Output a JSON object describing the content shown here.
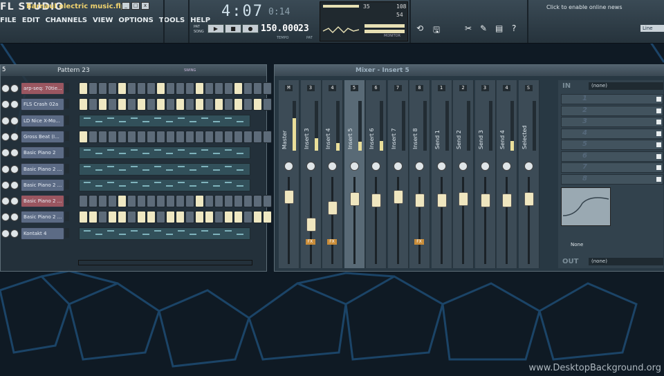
{
  "app": {
    "logo": "FL STUDIO",
    "project_title": "Barnaul electric music.flp"
  },
  "menu": [
    "FILE",
    "EDIT",
    "CHANNELS",
    "VIEW",
    "OPTIONS",
    "TOOLS",
    "HELP"
  ],
  "transport": {
    "song_position": "4:07",
    "song_ticks": "0:14",
    "tempo": "150.000",
    "tempo_label": "TEMPO",
    "pattern": "23",
    "pattern_label": "PAT",
    "mode_pat": "PAT",
    "mode_song": "SONG"
  },
  "monitor": {
    "val1": "35",
    "val2": "108",
    "val3": "54",
    "label": "MONITOR"
  },
  "news": {
    "text": "Click to enable online news"
  },
  "snap": {
    "value": "Line"
  },
  "channel_rack": {
    "number": "5",
    "pattern_name": "Pattern 23",
    "swing_label": "SWING",
    "channels": [
      {
        "name": "arp-seq: 70tie...",
        "style": "red",
        "steps": [
          1,
          0,
          0,
          0,
          1,
          0,
          0,
          0,
          1,
          0,
          0,
          0,
          1,
          0,
          0,
          0,
          1,
          0,
          0,
          0
        ]
      },
      {
        "name": "FLS Crash 02a",
        "style": "blue",
        "steps": [
          1,
          0,
          1,
          0,
          1,
          0,
          1,
          0,
          1,
          0,
          1,
          0,
          1,
          0,
          1,
          0,
          1,
          0,
          1,
          0
        ]
      },
      {
        "name": "LD Nice X-Mo...",
        "style": "blue",
        "piano": true
      },
      {
        "name": "Gross Beat (I...",
        "style": "blue",
        "steps": [
          1,
          0,
          0,
          0,
          0,
          0,
          0,
          0,
          0,
          0,
          0,
          0,
          0,
          0,
          0,
          0,
          0,
          0,
          0,
          0
        ]
      },
      {
        "name": "Basic Piano 2",
        "style": "blue",
        "piano": true
      },
      {
        "name": "Basic Piano 2 ...",
        "style": "blue",
        "piano": true
      },
      {
        "name": "Basic Piano 2 ...",
        "style": "blue",
        "piano": true
      },
      {
        "name": "Basic Piano 2 ...",
        "style": "red",
        "steps": [
          0,
          0,
          0,
          0,
          1,
          0,
          0,
          0,
          0,
          0,
          0,
          0,
          1,
          0,
          0,
          0,
          0,
          0,
          0,
          0
        ]
      },
      {
        "name": "Basic Piano 2 ...",
        "style": "blue",
        "steps": [
          1,
          1,
          0,
          1,
          1,
          0,
          1,
          1,
          0,
          1,
          1,
          0,
          1,
          1,
          0,
          1,
          1,
          0,
          1,
          1
        ]
      },
      {
        "name": "Kontakt 4",
        "style": "blue",
        "piano": true
      }
    ]
  },
  "mixer": {
    "title": "Mixer - Insert 5",
    "tracks": [
      {
        "name": "Master",
        "num": "M",
        "meter": 0.65,
        "fader": 0.82,
        "fx": false
      },
      {
        "name": "Insert 3",
        "num": "3",
        "meter": 0.25,
        "fader": 0.45,
        "fx": true
      },
      {
        "name": "Insert 4",
        "num": "4",
        "meter": 0.15,
        "fader": 0.68,
        "fx": true
      },
      {
        "name": "Insert 5",
        "num": "5",
        "meter": 0.18,
        "fader": 0.8,
        "fx": false,
        "selected": true
      },
      {
        "name": "Insert 6",
        "num": "6",
        "meter": 0.2,
        "fader": 0.78,
        "fx": false
      },
      {
        "name": "Insert 7",
        "num": "7",
        "meter": 0.0,
        "fader": 0.82,
        "fx": false
      },
      {
        "name": "Insert 8",
        "num": "8",
        "meter": 0.0,
        "fader": 0.78,
        "fx": true
      },
      {
        "name": "Send 1",
        "num": "1",
        "meter": 0.0,
        "fader": 0.78,
        "fx": false
      },
      {
        "name": "Send 2",
        "num": "2",
        "meter": 0.0,
        "fader": 0.8,
        "fx": false
      },
      {
        "name": "Send 3",
        "num": "3",
        "meter": 0.0,
        "fader": 0.78,
        "fx": false
      },
      {
        "name": "Send 4",
        "num": "4",
        "meter": 0.2,
        "fader": 0.78,
        "fx": false
      },
      {
        "name": "Selected",
        "num": "S",
        "meter": 0.0,
        "fader": 0.8,
        "fx": false
      }
    ],
    "in_label": "IN",
    "in_value": "(none)",
    "slots": [
      "1",
      "2",
      "3",
      "4",
      "5",
      "6",
      "7",
      "8"
    ],
    "none_label": "None",
    "out_label": "OUT",
    "out_value": "(none)"
  },
  "watermark": "www.DesktopBackground.org",
  "colors": {
    "step_on": "#efe8c2",
    "fader": "#efe6bf",
    "fx": "#c98d3a"
  }
}
